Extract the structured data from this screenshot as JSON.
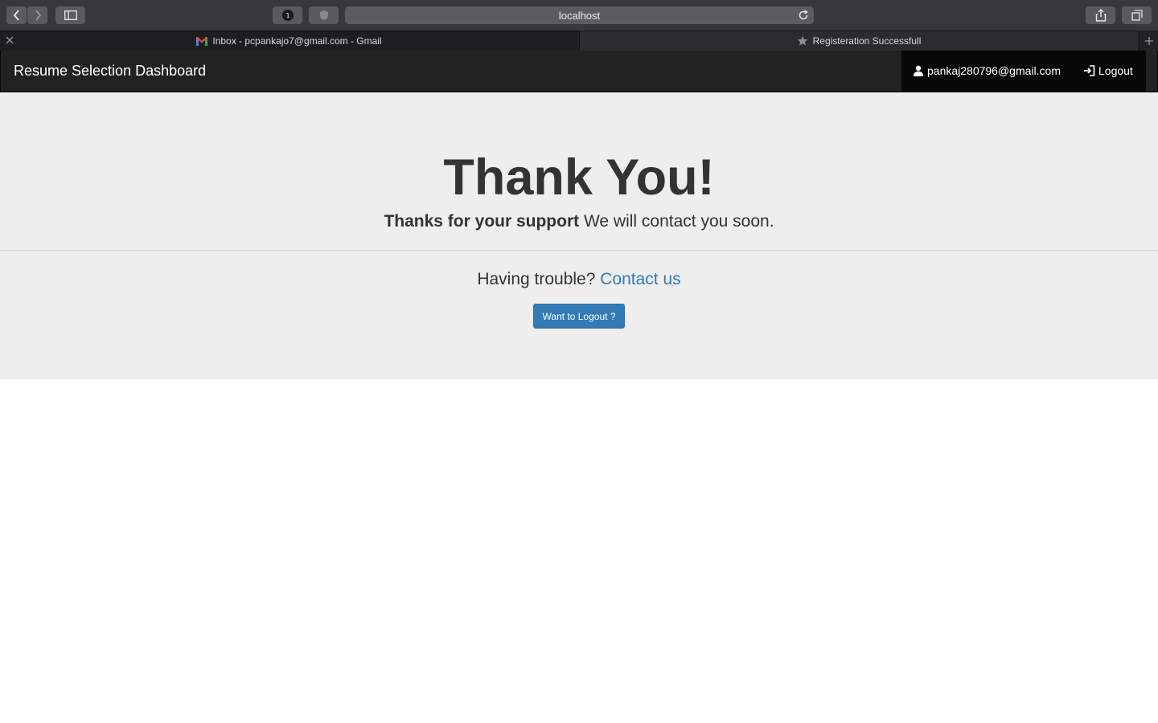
{
  "browser": {
    "address": "localhost",
    "tabs": [
      {
        "label": "Inbox - pcpankajo7@gmail.com - Gmail",
        "icon": "gmail-icon"
      },
      {
        "label": "Registeration Successfull",
        "icon": "star-icon"
      }
    ],
    "privacy_badge": "1"
  },
  "navbar": {
    "brand": "Resume Selection Dashboard",
    "user_email": "pankaj280796@gmail.com",
    "logout_label": "Logout"
  },
  "main": {
    "title": "Thank You!",
    "lead_strong": "Thanks for your support",
    "lead_text": " We will contact you soon.",
    "trouble_text": "Having trouble? ",
    "contact_link": "Contact us",
    "logout_button": "Want to Logout ?"
  },
  "colors": {
    "navbar_bg": "#222222",
    "jumbotron_bg": "#eeeeee",
    "link": "#337ab7",
    "primary_button": "#337ab7"
  }
}
